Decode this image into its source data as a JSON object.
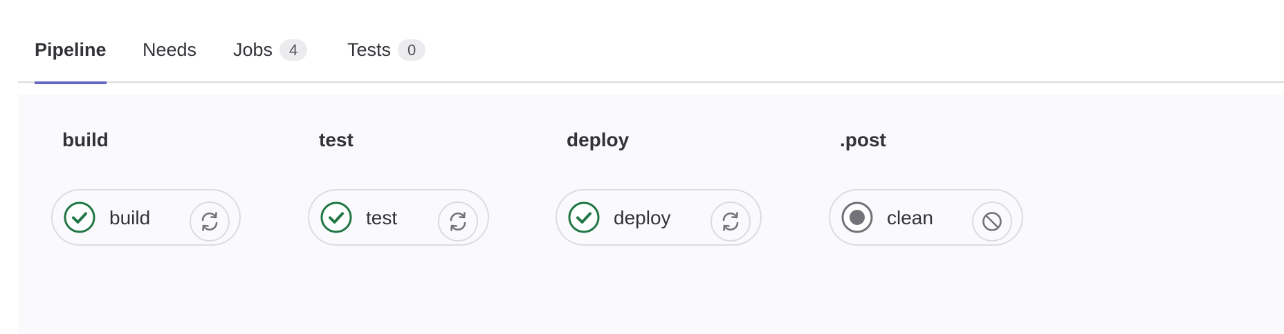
{
  "tabs": [
    {
      "label": "Pipeline",
      "active": true
    },
    {
      "label": "Needs"
    },
    {
      "label": "Jobs",
      "count": "4"
    },
    {
      "label": "Tests",
      "count": "0"
    }
  ],
  "stages": [
    {
      "title": "build",
      "job": {
        "name": "build",
        "status": "success",
        "status_icon": "check-circle-icon",
        "action_icon": "retry-icon"
      }
    },
    {
      "title": "test",
      "job": {
        "name": "test",
        "status": "success",
        "status_icon": "check-circle-icon",
        "action_icon": "retry-icon"
      }
    },
    {
      "title": "deploy",
      "job": {
        "name": "deploy",
        "status": "success",
        "status_icon": "check-circle-icon",
        "action_icon": "retry-icon"
      }
    },
    {
      "title": ".post",
      "job": {
        "name": "clean",
        "status": "skipped",
        "status_icon": "skipped-dot-icon",
        "action_icon": "cancel-icon"
      }
    }
  ],
  "colors": {
    "success": "#217645",
    "neutral": "#737278",
    "tab_underline": "#6666c4",
    "graph_bg": "#fafafc"
  }
}
